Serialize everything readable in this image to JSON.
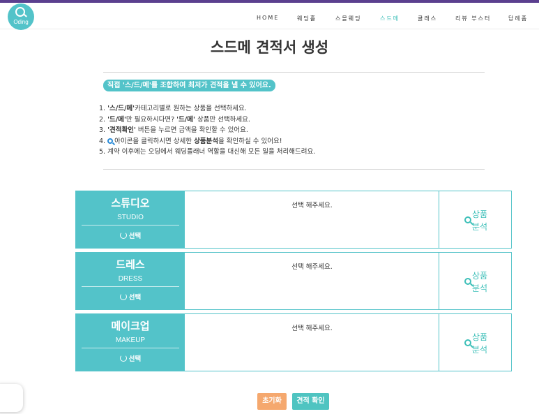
{
  "brand": {
    "logo_text": "Oding",
    "top_bar_color": "#5b3f8f",
    "accent_color": "#53c3c9"
  },
  "nav": {
    "items": [
      {
        "label": "HOME"
      },
      {
        "label": "웨딩홀"
      },
      {
        "label": "스몰웨딩"
      },
      {
        "label": "스드메",
        "active": true
      },
      {
        "label": "클래스"
      },
      {
        "label": "리뷰 부스터"
      },
      {
        "label": "답례품"
      }
    ]
  },
  "page": {
    "title": "스드메 견적서 생성",
    "badge": "직접 '스/드/메'를 조합하여 최저가 견적을 낼 수 있어요."
  },
  "instructions": {
    "line1": {
      "num": "1.",
      "bold": "'스/드/메'",
      "rest": "카테고리별로 원하는 상품을 선택하세요."
    },
    "line2": {
      "num": "2.",
      "bold1": "'드/메'",
      "mid": "만 필요하시다면? ",
      "bold2": "'드/메'",
      "rest": " 상품만 선택하세요."
    },
    "line3": {
      "num": "3.",
      "bold": "'견적확인'",
      "rest": " 버튼을 누르면 금액을 확인할 수 있어요."
    },
    "line4": {
      "num": "4.",
      "pre": "아이콘을 클릭하시면 상세한 ",
      "bold": "상품분석",
      "rest": "을 확인하실 수 있어요!"
    },
    "line5": {
      "num": "5.",
      "rest": "계약 이후에는 오딩에서 웨딩플래너 역할을 대신해 모든 일을 처리해드려요."
    }
  },
  "categories": [
    {
      "name": "스튜디오",
      "name_en": "STUDIO",
      "select_label": "선택",
      "selection": "선택 해주세요.",
      "analyze_label": "상품 분석"
    },
    {
      "name": "드레스",
      "name_en": "DRESS",
      "select_label": "선택",
      "selection": "선택 해주세요.",
      "analyze_label": "상품 분석"
    },
    {
      "name": "메이크업",
      "name_en": "MAKEUP",
      "select_label": "선택",
      "selection": "선택 해주세요.",
      "analyze_label": "상품 분석"
    }
  ],
  "actions": {
    "reset_label": "초기화",
    "confirm_label": "견적 확인",
    "reset_color": "#f5a86e",
    "confirm_color": "#4fc4c1"
  },
  "icons": {
    "logo": "magnifier-logo-icon",
    "select": "refresh-icon",
    "analyze": "search-icon",
    "instruction": "search-icon"
  }
}
